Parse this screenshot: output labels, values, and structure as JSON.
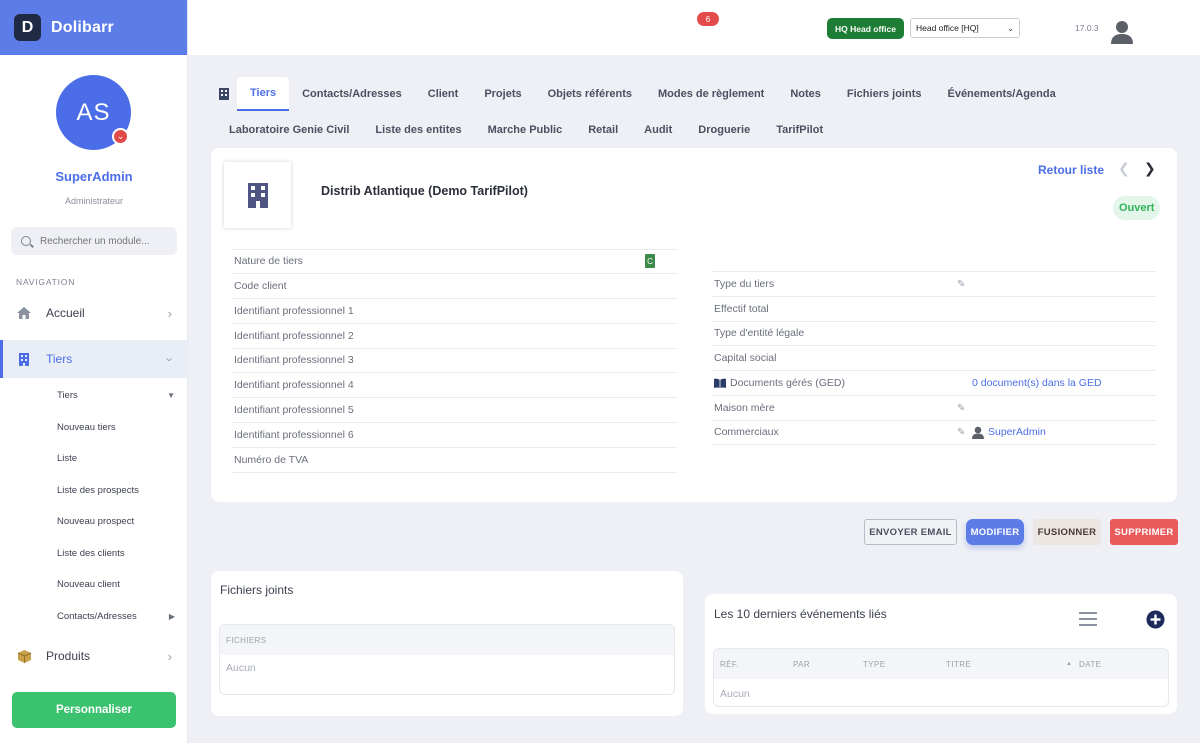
{
  "brand": {
    "name": "Dolibarr",
    "logo_letter": "D"
  },
  "user": {
    "initials": "AS",
    "name": "SuperAdmin",
    "role": "Administrateur"
  },
  "sidebar": {
    "search_placeholder": "Rechercher un module...",
    "nav_title": "NAVIGATION",
    "items": [
      {
        "label": "Accueil",
        "icon": "home-icon"
      },
      {
        "label": "Tiers",
        "icon": "building-icon"
      },
      {
        "label": "Produits",
        "icon": "cube-icon"
      }
    ],
    "sub_items": [
      "Tiers",
      "Nouveau tiers",
      "Liste",
      "Liste des prospects",
      "Nouveau prospect",
      "Liste des clients",
      "Nouveau client",
      "Contacts/Adresses"
    ],
    "personalize_label": "Personnaliser"
  },
  "topbar": {
    "notif_count": "6",
    "entity_badge": "HQ Head office",
    "entity_select": "Head office [HQ]",
    "version": "17.0.3"
  },
  "tabs_row1": [
    "Tiers",
    "Contacts/Adresses",
    "Client",
    "Projets",
    "Objets référents",
    "Modes de règlement",
    "Notes",
    "Fichiers joints",
    "Événements/Agenda"
  ],
  "tabs_row2": [
    "Laboratoire Genie Civil",
    "Liste des entites",
    "Marche Public",
    "Retail",
    "Audit",
    "Droguerie",
    "TarifPilot"
  ],
  "company": {
    "name": "Distrib Atlantique (Demo TarifPilot)",
    "back_label": "Retour liste",
    "status": "Ouvert"
  },
  "fields_left": [
    {
      "label": "Nature de tiers",
      "badge": "C"
    },
    {
      "label": "Code client"
    },
    {
      "label": "Identifiant professionnel 1"
    },
    {
      "label": "Identifiant professionnel 2"
    },
    {
      "label": "Identifiant professionnel 3"
    },
    {
      "label": "Identifiant professionnel 4"
    },
    {
      "label": "Identifiant professionnel 5"
    },
    {
      "label": "Identifiant professionnel 6"
    },
    {
      "label": "Numéro de TVA"
    }
  ],
  "fields_right": [
    {
      "label": "Type du tiers"
    },
    {
      "label": "Effectif total"
    },
    {
      "label": "Type d'entité légale"
    },
    {
      "label": "Capital social"
    },
    {
      "label": "Documents gérés (GED)",
      "value": "0 document(s) dans la GED"
    },
    {
      "label": "Maison mère"
    },
    {
      "label": "Commerciaux",
      "value": "SuperAdmin"
    }
  ],
  "actions": {
    "email": "ENVOYER EMAIL",
    "modify": "MODIFIER",
    "merge": "FUSIONNER",
    "delete": "SUPPRIMER"
  },
  "files_card": {
    "title": "Fichiers joints",
    "header": "FICHIERS",
    "empty": "Aucun"
  },
  "events_card": {
    "title": "Les 10 derniers événements liés",
    "columns": [
      "RÉF.",
      "PAR",
      "TYPE",
      "TITRE",
      "DATE"
    ],
    "empty": "Aucun"
  },
  "colors": {
    "accent": "#5c7ce8",
    "success": "#3ac26e",
    "danger": "#ea5a5a",
    "entity": "#1d7d35"
  }
}
